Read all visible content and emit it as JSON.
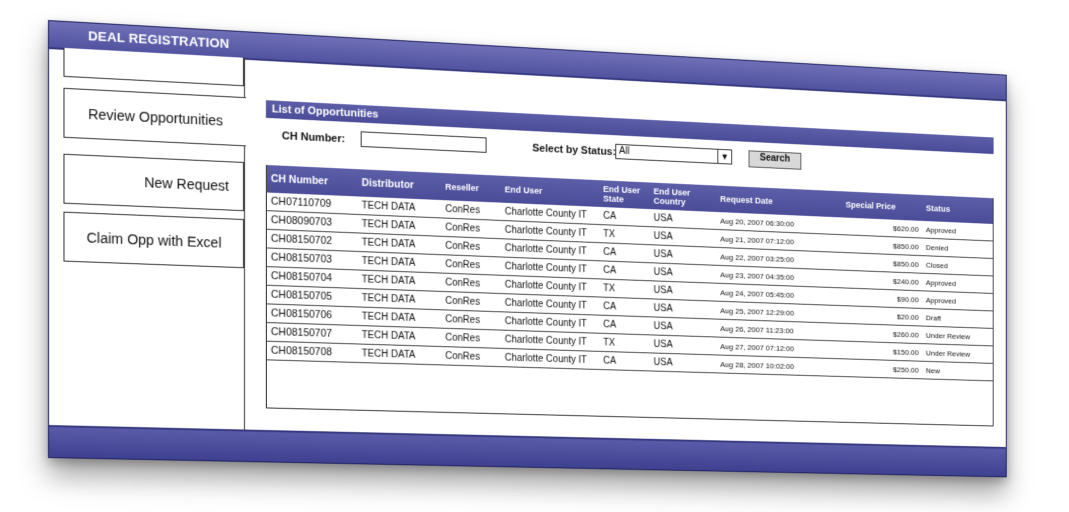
{
  "app": {
    "title": "DEAL REGISTRATION"
  },
  "sidebar": {
    "items": [
      {
        "label": "Review Opportunities"
      },
      {
        "label": "New Request"
      },
      {
        "label": "Claim Opp with Excel"
      }
    ]
  },
  "section": {
    "title": "List of Opportunities"
  },
  "filter": {
    "ch_label": "CH Number:",
    "ch_value": "",
    "status_label": "Select by Status:",
    "status_selected": "All",
    "search_label": "Search"
  },
  "table": {
    "columns": [
      "CH Number",
      "Distributor",
      "Reseller",
      "End User",
      "End User State",
      "End User Country",
      "Request Date",
      "Special Price",
      "Status"
    ],
    "rows": [
      [
        "CH07110709",
        "TECH DATA",
        "ConRes",
        "Charlotte County IT",
        "CA",
        "USA",
        "Aug 20, 2007 06:30:00",
        "$620.00",
        "Approved"
      ],
      [
        "CH08090703",
        "TECH DATA",
        "ConRes",
        "Charlotte County IT",
        "TX",
        "USA",
        "Aug 21, 2007 07:12:00",
        "$850.00",
        "Denied"
      ],
      [
        "CH08150702",
        "TECH DATA",
        "ConRes",
        "Charlotte County IT",
        "CA",
        "USA",
        "Aug 22, 2007 03:25:00",
        "$850.00",
        "Closed"
      ],
      [
        "CH08150703",
        "TECH DATA",
        "ConRes",
        "Charlotte County IT",
        "CA",
        "USA",
        "Aug 23, 2007 04:35:00",
        "$240.00",
        "Approved"
      ],
      [
        "CH08150704",
        "TECH DATA",
        "ConRes",
        "Charlotte County IT",
        "TX",
        "USA",
        "Aug 24, 2007 05:45:00",
        "$90.00",
        "Approved"
      ],
      [
        "CH08150705",
        "TECH DATA",
        "ConRes",
        "Charlotte County IT",
        "CA",
        "USA",
        "Aug 25, 2007 12:29:00",
        "$20.00",
        "Draft"
      ],
      [
        "CH08150706",
        "TECH DATA",
        "ConRes",
        "Charlotte County IT",
        "CA",
        "USA",
        "Aug 26, 2007 11:23:00",
        "$260.00",
        "Under Review"
      ],
      [
        "CH08150707",
        "TECH DATA",
        "ConRes",
        "Charlotte County IT",
        "TX",
        "USA",
        "Aug 27, 2007 07:12:00",
        "$150.00",
        "Under Review"
      ],
      [
        "CH08150708",
        "TECH DATA",
        "ConRes",
        "Charlotte County IT",
        "CA",
        "USA",
        "Aug 28, 2007 10:02:00",
        "$250.00",
        "New"
      ]
    ]
  },
  "colors": {
    "bar": "#5253a0",
    "bar_dark": "#383a80",
    "header": "#4b4c98"
  },
  "icons": {
    "dropdown": "dropdown-arrow-icon"
  }
}
